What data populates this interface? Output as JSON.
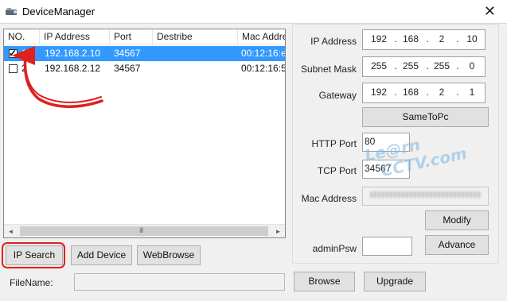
{
  "window": {
    "title": "DeviceManager",
    "close_glyph": "✕"
  },
  "list": {
    "columns": [
      "NO.",
      "IP Address",
      "Port",
      "Destribe",
      "Mac Address"
    ],
    "rows": [
      {
        "no": "1",
        "ip": "192.168.2.10",
        "port": "34567",
        "describe": "",
        "mac": "00:12:16:e",
        "checked": true,
        "selected": true
      },
      {
        "no": "2",
        "ip": "192.168.2.12",
        "port": "34567",
        "describe": "",
        "mac": "00:12:16:5",
        "checked": false,
        "selected": false
      }
    ],
    "scroll_left": "◄",
    "scroll_right": "►",
    "scroll_grip": "III"
  },
  "buttons": {
    "ip_search": "IP Search",
    "add_device": "Add Device",
    "web_browse": "WebBrowse",
    "browse": "Browse",
    "upgrade": "Upgrade",
    "same_to_pc": "SameToPc",
    "modify": "Modify",
    "advance": "Advance"
  },
  "file": {
    "label": "FileName:",
    "value": ""
  },
  "config": {
    "ip_address_label": "IP Address",
    "ip_address": [
      "192",
      "168",
      "2",
      "10"
    ],
    "subnet_mask_label": "Subnet Mask",
    "subnet_mask": [
      "255",
      "255",
      "255",
      "0"
    ],
    "gateway_label": "Gateway",
    "gateway": [
      "192",
      "168",
      "2",
      "1"
    ],
    "http_port_label": "HTTP Port",
    "http_port": "80",
    "tcp_port_label": "TCP Port",
    "tcp_port": "34567",
    "mac_address_label": "Mac Address",
    "admin_psw_label": "adminPsw",
    "admin_psw": ""
  },
  "watermark": {
    "line1": "Le@rn",
    "line2": "CCTV.com"
  },
  "colors": {
    "selection": "#3399ff",
    "annotation_red": "#e0201e",
    "watermark_blue": "#7fb6e0"
  }
}
